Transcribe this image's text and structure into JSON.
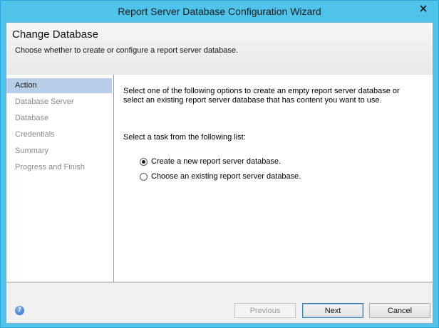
{
  "window": {
    "title": "Report Server Database Configuration Wizard"
  },
  "header": {
    "title": "Change Database",
    "subtitle": "Choose whether to create or configure a report server database."
  },
  "nav": {
    "items": [
      {
        "label": "Action"
      },
      {
        "label": "Database Server"
      },
      {
        "label": "Database"
      },
      {
        "label": "Credentials"
      },
      {
        "label": "Summary"
      },
      {
        "label": "Progress and Finish"
      }
    ],
    "selected": "Action"
  },
  "content": {
    "intro": "Select one of the following options to create an empty report server database or select an existing report server database that has content you want to use.",
    "task_label": "Select a task from the following list:",
    "options": [
      {
        "label": "Create a new report server database.",
        "checked": true
      },
      {
        "label": "Choose an existing report server database.",
        "checked": false
      }
    ]
  },
  "footer": {
    "previous_label": "Previous",
    "next_label": "Next",
    "cancel_label": "Cancel",
    "help_icon": "help-icon"
  },
  "colors": {
    "window_frame": "#4fc3e9",
    "nav_selected": "#b8cde8"
  }
}
